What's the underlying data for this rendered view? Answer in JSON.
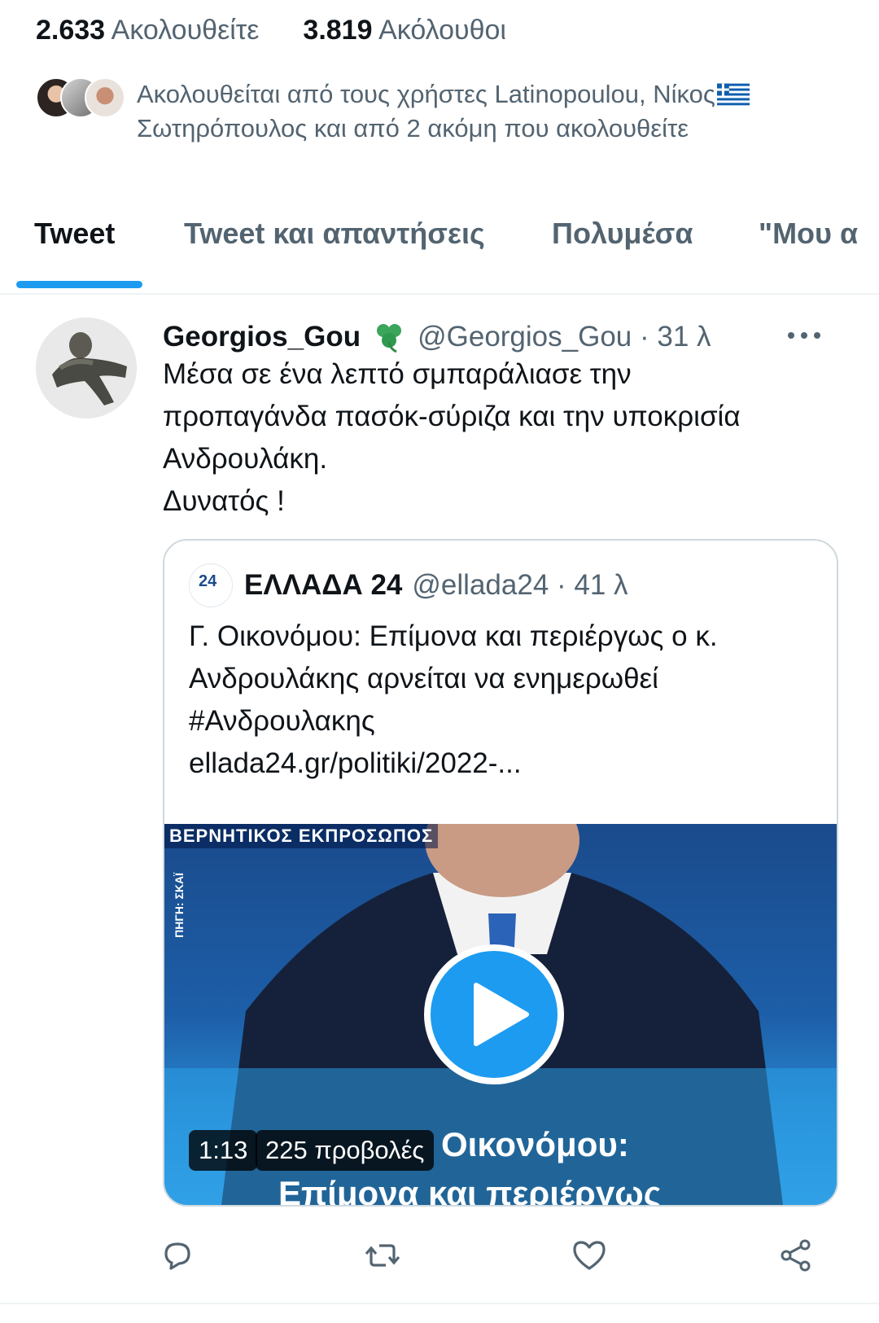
{
  "profile_stats": {
    "following_count": "2.633",
    "following_label": "Ακολουθείτε",
    "followers_count": "3.819",
    "followers_label": "Ακόλουθοι"
  },
  "followed_by": {
    "text": "Ακολουθείται από τους χρήστες Latinopoulou, Νίκος",
    "text2": "Σωτηρόπουλος και από 2 ακόμη που ακολουθείτε"
  },
  "tabs": [
    {
      "label": "Tweet",
      "active": true
    },
    {
      "label": "Tweet και απαντήσεις",
      "active": false
    },
    {
      "label": "Πολυμέσα",
      "active": false
    },
    {
      "label": "\"Μου α",
      "active": false
    }
  ],
  "tweet": {
    "author_name": "Georgios_Gou",
    "author_handle": "@Georgios_Gou · 31 λ",
    "text_lines": [
      "Μέσα σε ένα λεπτό σμπαράλιασε την",
      "προπαγάνδα πασόκ-σύριζα και την υποκρισία",
      "Ανδρουλάκη.",
      "Δυνατός !"
    ],
    "quote": {
      "logo_text": "24",
      "author_name": "ΕΛΛΑΔΑ 24",
      "author_handle": "@ellada24 · 41 λ",
      "text_lines": [
        "Γ. Οικονόμου:  Επίμονα και περιέργως ο κ.",
        "Ανδρουλάκης αρνείται να ενημερωθεί",
        "#Ανδρουλακης",
        "ellada24.gr/politiki/2022-..."
      ],
      "video": {
        "banner": "ΒΕΡΝΗΤΙΚΟΣ ΕΚΠΡΟΣΩΠΟΣ",
        "side_label": "ΠΗΓΗ: ΣΚΑΪ",
        "caption": "Οικονόμου:",
        "caption2": "Επίμονα και περιέργως",
        "duration": "1:13",
        "views": "225 προβολές"
      }
    }
  },
  "actions": [
    "reply-icon",
    "retweet-icon",
    "like-icon",
    "share-icon"
  ],
  "colors": {
    "accent": "#1d9bf0",
    "secondary_text": "#536471",
    "primary_text": "#0f1419"
  }
}
